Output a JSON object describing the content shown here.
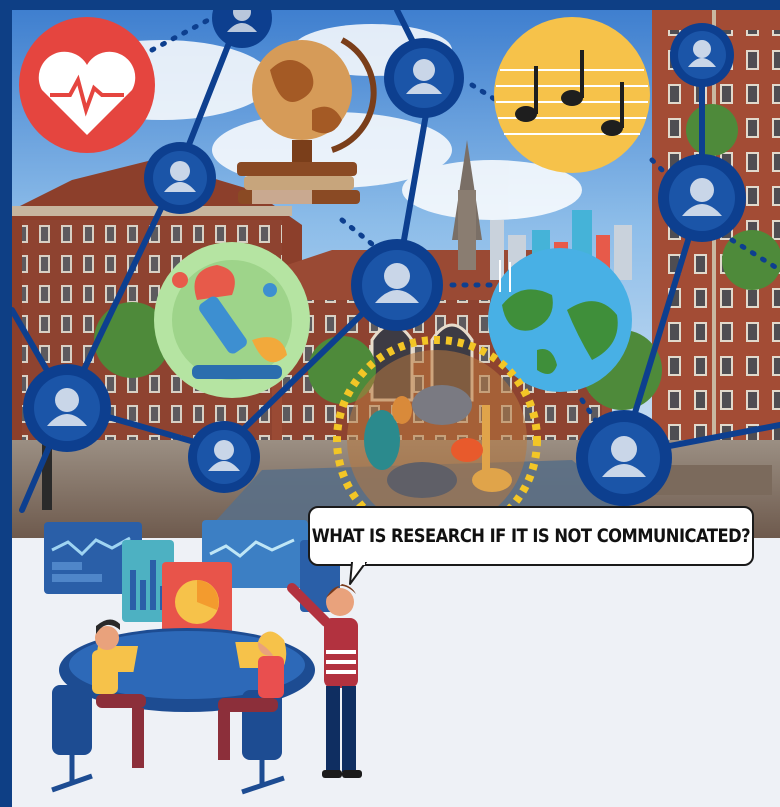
{
  "poster": {
    "caption": "WHAT IS RESEARCH IF IT IS NOT COMMUNICATED?"
  },
  "colors": {
    "frame_blue": "#0e3f85",
    "network_blue": "#0d3f8f",
    "sky": "#7fb4e6",
    "brick": "#9a4a34",
    "heart_red": "#e5453f",
    "music_yellow": "#f6c24a",
    "lower_panel": "#eef1f6"
  },
  "icons": [
    "heart-rate-icon",
    "globe-stand-icon",
    "music-notes-icon",
    "microscope-icon",
    "earth-city-icon",
    "biodiversity-animals-icon",
    "person-node-icon"
  ]
}
